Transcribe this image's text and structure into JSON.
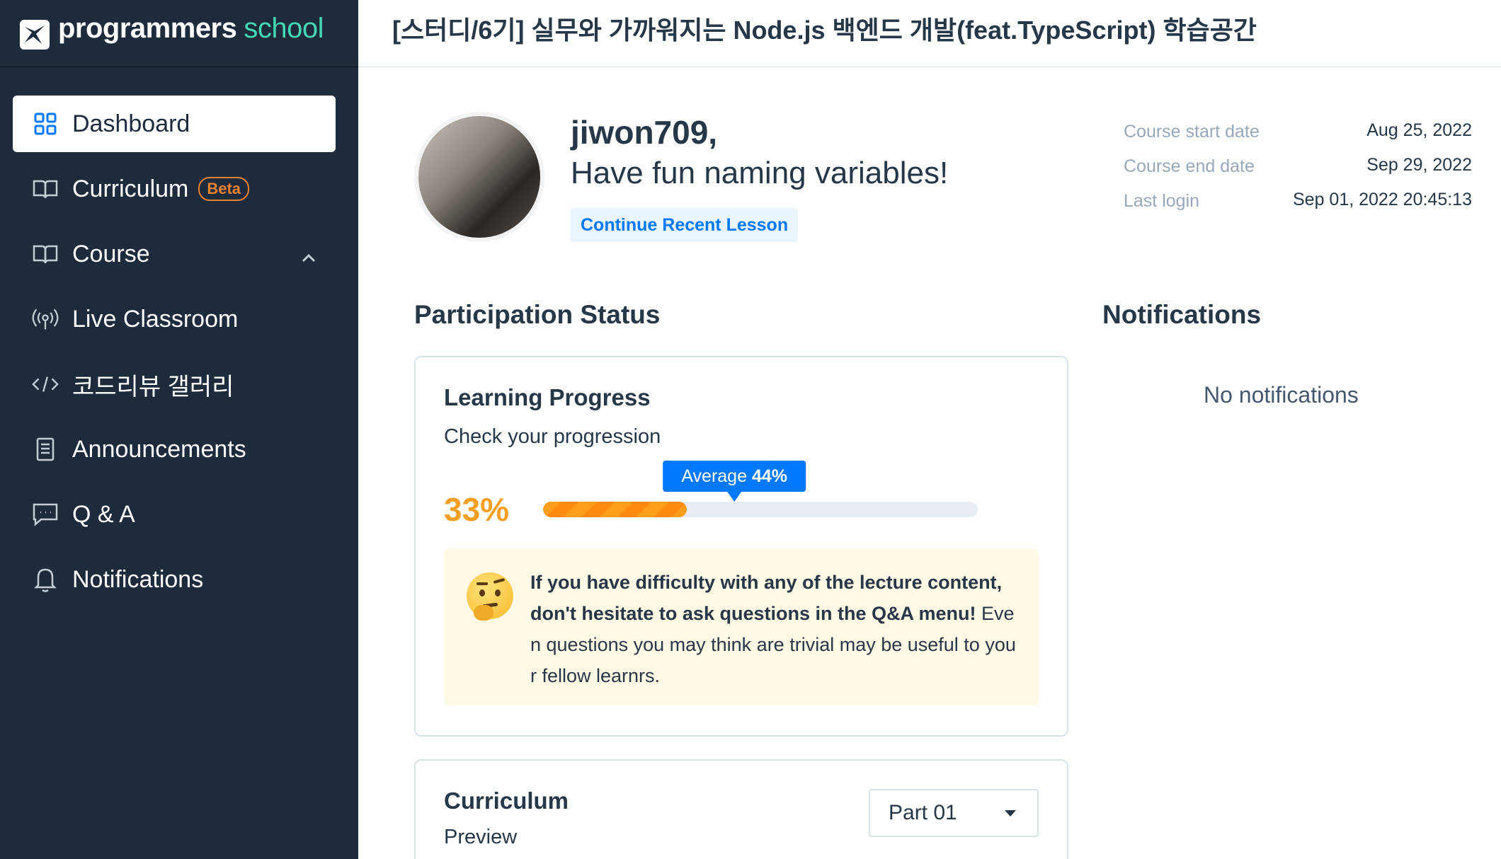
{
  "logo": {
    "brand": "programmers",
    "suffix": "school"
  },
  "header": {
    "title": "[스터디/6기] 실무와 가까워지는 Node.js 백엔드 개발(feat.TypeScript) 학습공간"
  },
  "sidebar": {
    "items": [
      {
        "label": "Dashboard",
        "icon": "dashboard-grid-icon",
        "active": true
      },
      {
        "label": "Curriculum",
        "icon": "book-icon",
        "badge": "Beta"
      },
      {
        "label": "Course",
        "icon": "book-icon"
      },
      {
        "label": "Live Classroom",
        "icon": "broadcast-icon"
      },
      {
        "label": "코드리뷰 갤러리",
        "icon": "code-icon"
      },
      {
        "label": "Announcements",
        "icon": "document-icon"
      },
      {
        "label": "Q & A",
        "icon": "chat-icon"
      },
      {
        "label": "Notifications",
        "icon": "bell-icon"
      }
    ]
  },
  "profile": {
    "username": "jiwon709,",
    "message": "Have fun naming variables!",
    "continue_label": "Continue Recent Lesson"
  },
  "meta": [
    {
      "label": "Course start date",
      "value": "Aug 25, 2022"
    },
    {
      "label": "Course end date",
      "value": "Sep 29, 2022"
    },
    {
      "label": "Last login",
      "value": "Sep 01, 2022 20:45:13"
    }
  ],
  "participation": {
    "title": "Participation Status",
    "card_title": "Learning Progress",
    "card_subtitle": "Check your progression",
    "progress_label": "33%",
    "progress_value": 33,
    "average_label": "Average",
    "average_value_label": "44%",
    "average_value": 44,
    "tip_bold": "If you have difficulty with any of the lecture content, don't hesitate to ask questions in the Q&A menu!",
    "tip_normal": "Even questions you may think are trivial may be useful to your fellow learnrs."
  },
  "notifications": {
    "title": "Notifications",
    "empty": "No notifications"
  },
  "curriculum": {
    "title": "Curriculum",
    "subtitle": "Preview",
    "selected": "Part 01"
  },
  "colors": {
    "sidebar": "#1e2b3c",
    "accent": "#0078ff",
    "progress": "#ff9e1b",
    "tip_bg": "#fff9e6"
  }
}
